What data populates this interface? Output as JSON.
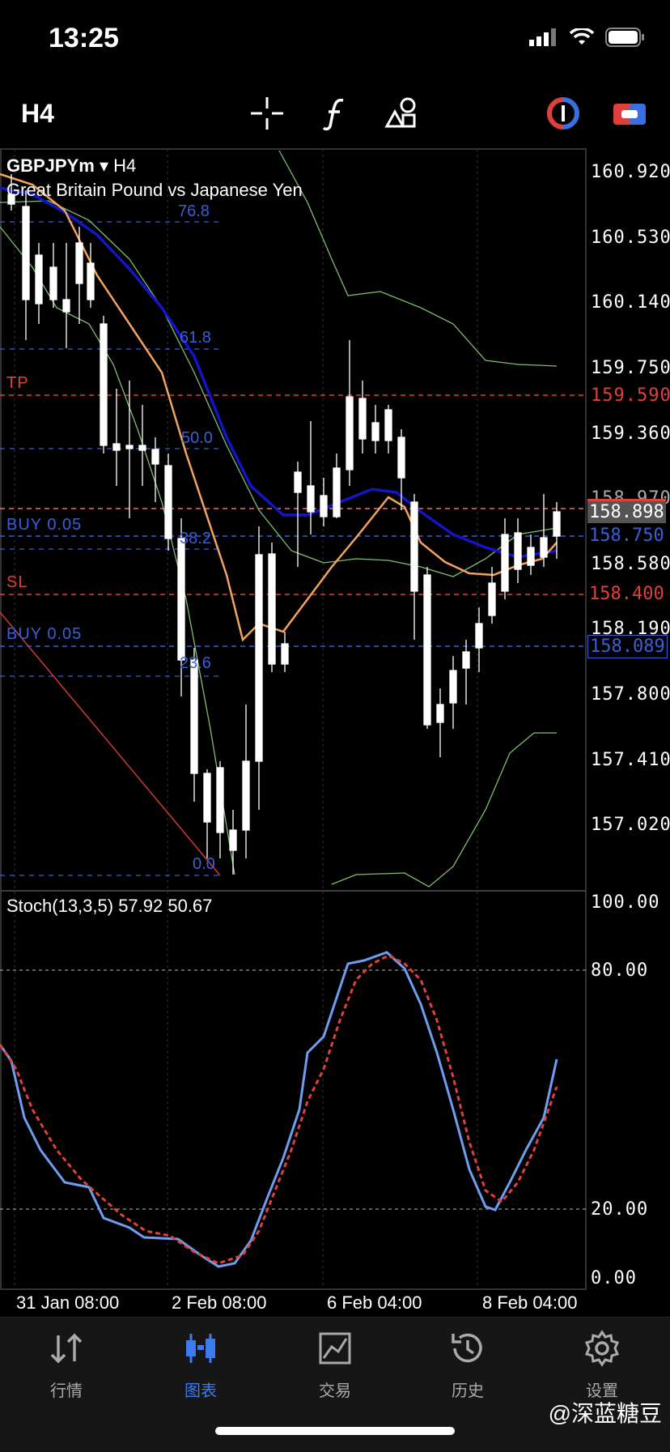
{
  "status": {
    "time": "13:25"
  },
  "toolbar": {
    "timeframe": "H4"
  },
  "chart": {
    "symbol": "GBPJPYm",
    "timeframe": "H4",
    "description": "Great Britain Pound vs Japanese Yen",
    "price_axis": [
      "160.920",
      "160.530",
      "160.140",
      "159.750",
      "159.590",
      "159.360",
      "158.970",
      "158.898",
      "158.750",
      "158.580",
      "158.400",
      "158.190",
      "158.089",
      "157.800",
      "157.410",
      "157.020"
    ],
    "current_price": "158.898",
    "tp_price": "159.590",
    "sl_price": "158.400",
    "buy1_price": "158.750",
    "buy2_price": "158.089",
    "tags": {
      "tp": "TP",
      "sl": "SL",
      "buy1": "BUY 0.05",
      "buy2": "BUY 0.05"
    },
    "fib_levels": [
      "76.8",
      "61.8",
      "50.0",
      "38.2",
      "23.6",
      "0.0"
    ],
    "time_axis": [
      "31 Jan 08:00",
      "2 Feb 08:00",
      "6 Feb 04:00",
      "8 Feb 04:00"
    ],
    "colors": {
      "up": "#ffffff",
      "ma_fast": "#f3a35b",
      "ma_slow": "#1414c8",
      "bands": "#7fbf6f",
      "tp_sl": "#e0403c",
      "buy": "#3a5fd8",
      "stoch_k": "#6d9ff0",
      "stoch_d": "#e0403c"
    }
  },
  "stoch": {
    "title": "Stoch(13,3,5) 57.92 50.67",
    "axis": [
      "100.00",
      "80.00",
      "20.00",
      "0.00"
    ]
  },
  "tabs": [
    {
      "label": "行情",
      "icon": "quotes-icon"
    },
    {
      "label": "图表",
      "icon": "chart-icon"
    },
    {
      "label": "交易",
      "icon": "trade-icon"
    },
    {
      "label": "历史",
      "icon": "history-icon"
    },
    {
      "label": "设置",
      "icon": "settings-icon"
    }
  ],
  "watermark": "@深蓝糖豆"
}
